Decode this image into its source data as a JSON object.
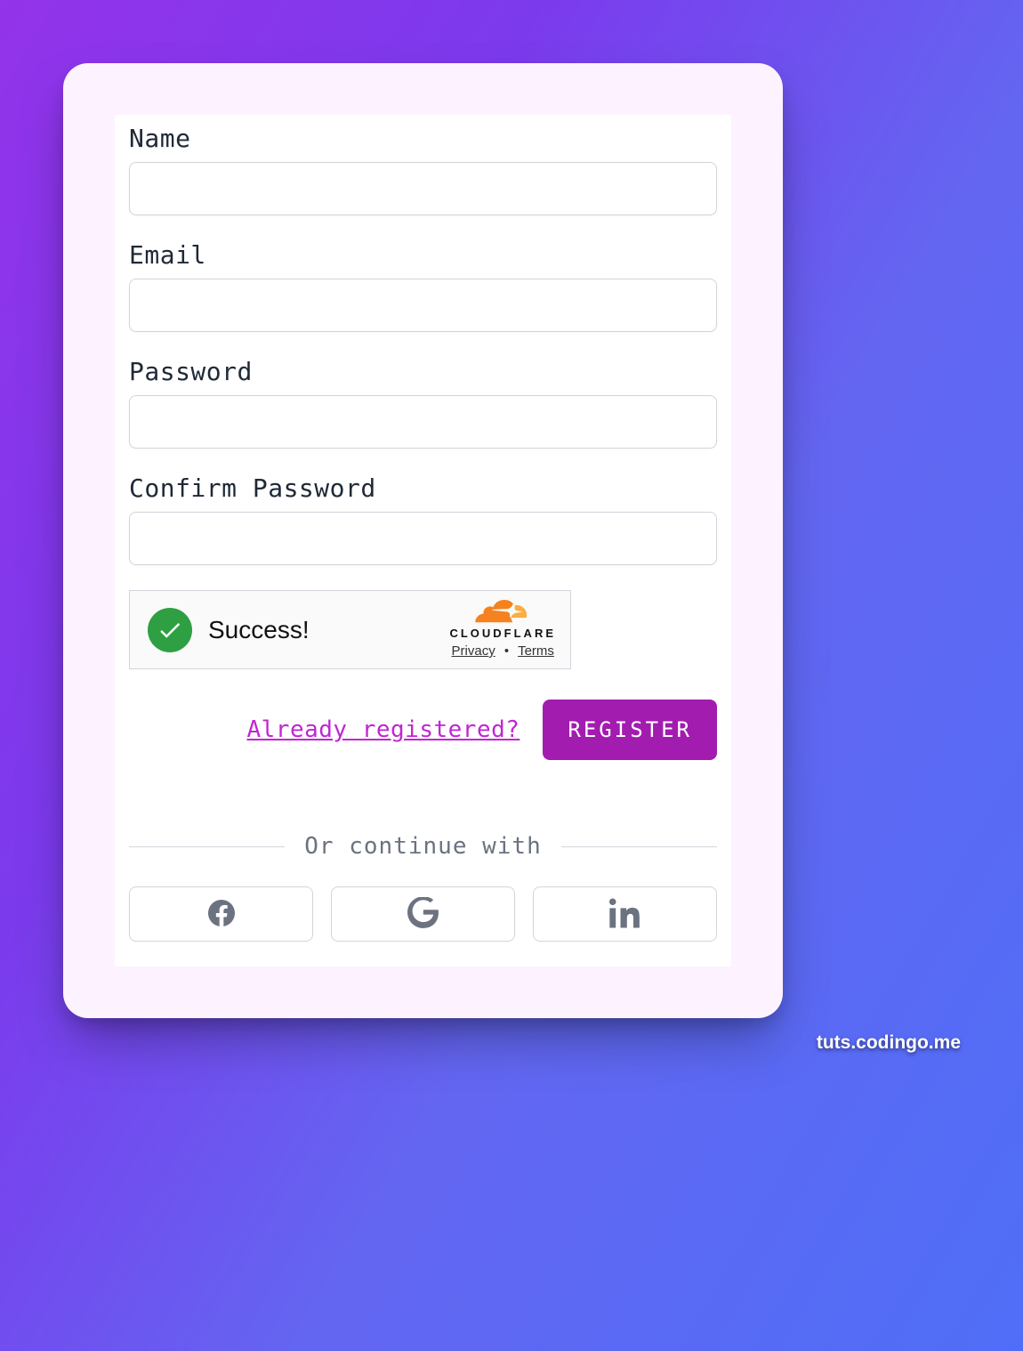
{
  "form": {
    "name_label": "Name",
    "name_value": "",
    "email_label": "Email",
    "email_value": "",
    "password_label": "Password",
    "password_value": "",
    "confirm_label": "Confirm Password",
    "confirm_value": ""
  },
  "captcha": {
    "status_text": "Success!",
    "provider": "CLOUDFLARE",
    "privacy_label": "Privacy",
    "terms_label": "Terms"
  },
  "actions": {
    "already_text": "Already registered?",
    "register_label": "REGISTER"
  },
  "divider": {
    "text": "Or continue with"
  },
  "social": {
    "facebook": "facebook",
    "google": "google",
    "linkedin": "linkedin"
  },
  "watermark": "tuts.codingo.me"
}
